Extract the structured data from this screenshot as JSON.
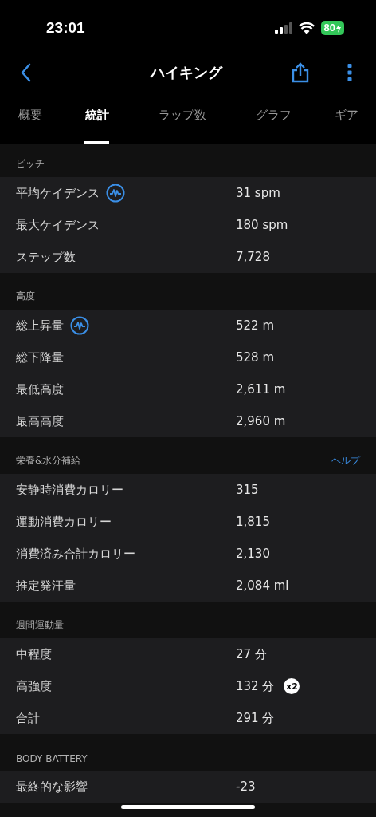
{
  "status_bar": {
    "time": "23:01",
    "battery": "80",
    "charging": true
  },
  "nav": {
    "title": "ハイキング"
  },
  "tabs": [
    {
      "label": "概要",
      "selected": false
    },
    {
      "label": "統計",
      "selected": true
    },
    {
      "label": "ラップ数",
      "selected": false
    },
    {
      "label": "グラフ",
      "selected": false
    },
    {
      "label": "ギア",
      "selected": false
    }
  ],
  "sections": [
    {
      "title": "ピッチ",
      "rows": [
        {
          "label": "平均ケイデンス",
          "value": "31 spm",
          "graph_icon": true
        },
        {
          "label": "最大ケイデンス",
          "value": "180 spm",
          "graph_icon": false
        },
        {
          "label": "ステップ数",
          "value": "7,728",
          "graph_icon": false
        }
      ]
    },
    {
      "title": "高度",
      "rows": [
        {
          "label": "総上昇量",
          "value": "522 m",
          "graph_icon": true
        },
        {
          "label": "総下降量",
          "value": "528 m",
          "graph_icon": false
        },
        {
          "label": "最低高度",
          "value": "2,611 m",
          "graph_icon": false
        },
        {
          "label": "最高高度",
          "value": "2,960 m",
          "graph_icon": false
        }
      ]
    },
    {
      "title": "栄養&水分補給",
      "link": "ヘルプ",
      "rows": [
        {
          "label": "安静時消費カロリー",
          "value": "315",
          "graph_icon": false
        },
        {
          "label": "運動消費カロリー",
          "value": "1,815",
          "graph_icon": false
        },
        {
          "label": "消費済み合計カロリー",
          "value": "2,130",
          "graph_icon": false
        },
        {
          "label": "推定発汗量",
          "value": "2,084 ml",
          "graph_icon": false
        }
      ]
    },
    {
      "title": "週間運動量",
      "rows": [
        {
          "label": "中程度",
          "value": "27 分",
          "graph_icon": false
        },
        {
          "label": "高強度",
          "value": "132 分",
          "graph_icon": false,
          "badge": "x2"
        },
        {
          "label": "合計",
          "value": "291 分",
          "graph_icon": false
        }
      ]
    },
    {
      "title": "BODY BATTERY",
      "rows": [
        {
          "label": "最終的な影響",
          "value": "-23",
          "graph_icon": false
        }
      ]
    }
  ]
}
